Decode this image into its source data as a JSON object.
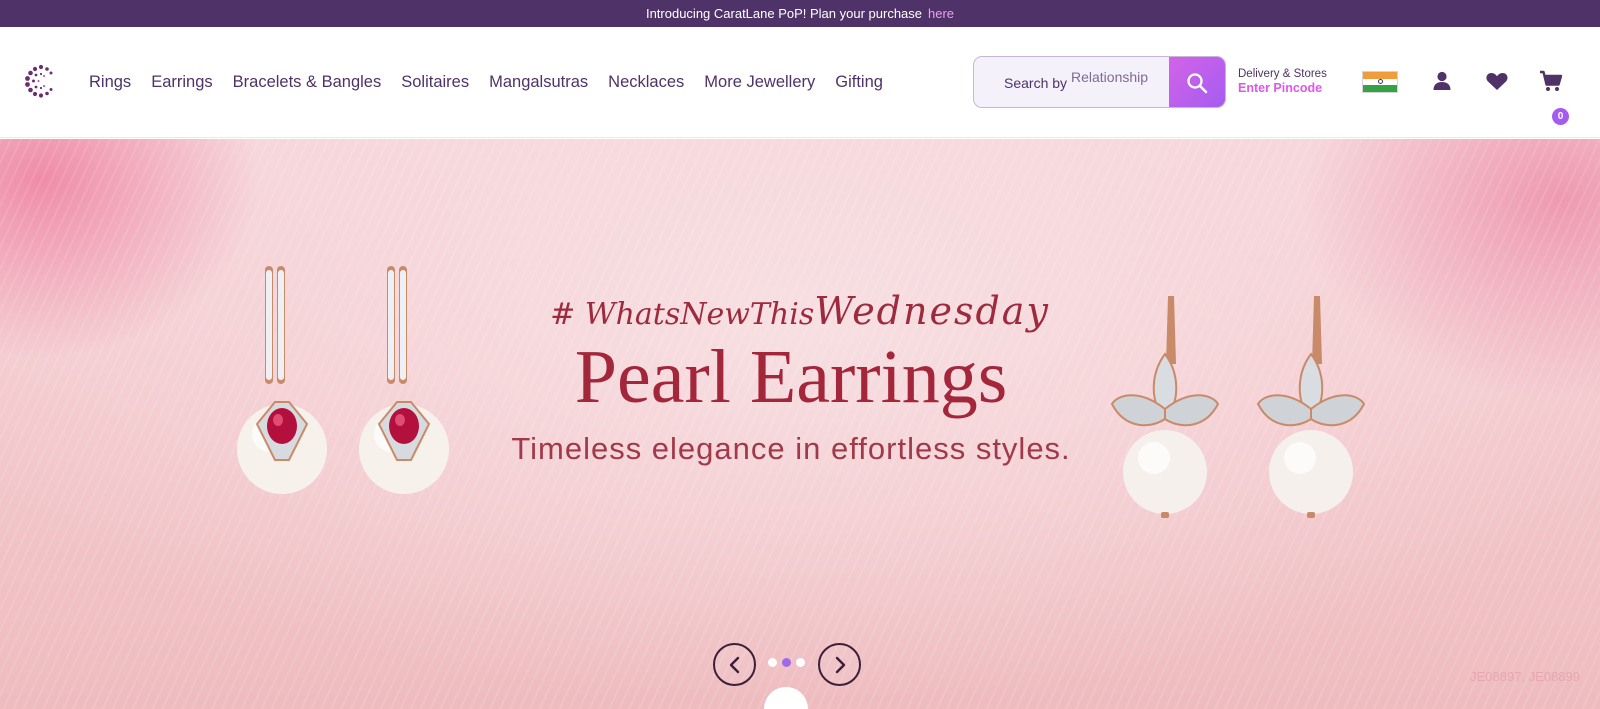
{
  "announcement": {
    "text": "Introducing CaratLane PoP! Plan your purchase",
    "link": "here"
  },
  "header": {
    "logo": "caratlane-logo-icon",
    "nav": [
      "Rings",
      "Earrings",
      "Bracelets & Bangles",
      "Solitaires",
      "Mangalsutras",
      "Necklaces",
      "More Jewellery",
      "Gifting"
    ],
    "search": {
      "label": "Search by",
      "rotating_text": "Relationship",
      "button_icon": "search-icon"
    },
    "delivery": {
      "title": "Delivery & Stores",
      "action": "Enter Pincode"
    },
    "country_icon": "india-flag-icon",
    "account_icon": "user-icon",
    "wishlist_icon": "heart-icon",
    "cart": {
      "icon": "cart-icon",
      "count": "0"
    }
  },
  "hero": {
    "hashtag_prefix": "# WhatsNewThis",
    "hashtag_script": "Wednesday",
    "headline": "Pearl Earrings",
    "subline": "Timeless elegance in effortless styles.",
    "sku": "JE08897, JE08899",
    "carousel": {
      "prev_icon": "chevron-left-icon",
      "next_icon": "chevron-right-icon",
      "slides": 3,
      "active_slide": 2
    }
  },
  "colors": {
    "brand_purple": "#4f3267",
    "accent_pink": "#de57e5",
    "search_gradient_start": "#d363e8",
    "search_gradient_end": "#a45cf0",
    "headline": "#a3263b"
  }
}
